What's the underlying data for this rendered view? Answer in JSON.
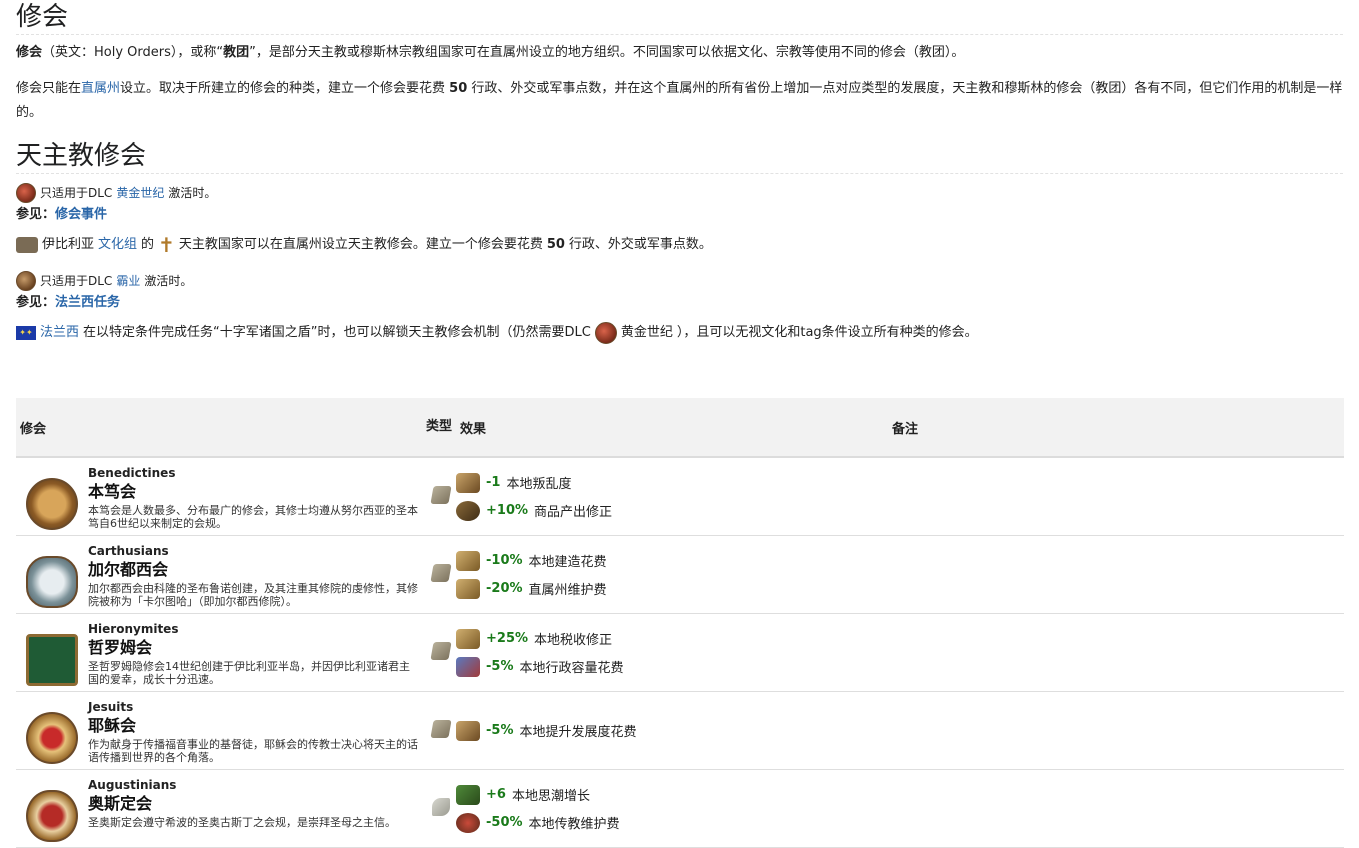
{
  "title": "修会",
  "intro": {
    "term": "修会",
    "part1": "（英文：Holy Orders），或称“",
    "alias": "教团",
    "part2": "”，是部分天主教或穆斯林宗教组国家可在直属州设立的地方组织。不同国家可以依据文化、宗教等使用不同的修会（教团）。"
  },
  "para2": {
    "a": "修会只能在",
    "link": "直属州",
    "b": "设立。取决于所建立的修会的种类，建立一个修会要花费 ",
    "num": "50",
    "c": " 行政、外交或军事点数，并在这个直属州的所有省份上增加一点对应类型的发展度，天主教和穆斯林的修会（教团）各有不同，但它们作用的机制是一样的。"
  },
  "section": "天主教修会",
  "dlc1": {
    "pre": "只适用于DLC",
    "link": "黄金世纪",
    "post": "激活时。",
    "icon": "golden-century-dlc-icon"
  },
  "see1": {
    "label": "参见：",
    "link": "修会事件"
  },
  "culture_line": {
    "a": "伊比利亚",
    "link": "文化组",
    "b": "的",
    "c": "天主教国家可以在直属州设立天主教修会。建立一个修会要花费 ",
    "num": "50",
    "d": " 行政、外交或军事点数。"
  },
  "dlc2": {
    "pre": "只适用于DLC",
    "link": "霸业",
    "post": "激活时。",
    "icon": "dominion-dlc-icon"
  },
  "see2": {
    "label": "参见：",
    "link": "法兰西任务"
  },
  "france_line": {
    "link": "法兰西",
    "a": "在以特定条件完成任务“十字军诸国之盾”时，也可以解锁天主教修会机制（仍然需要DLC",
    "dlc": "黄金世纪",
    "b": "），且可以无视文化和tag条件设立所有种类的修会。"
  },
  "table": {
    "headers": {
      "order": "修会",
      "type": "类型",
      "effect": "效果",
      "note": "备注"
    },
    "rows": [
      {
        "en": "Benedictines",
        "zh": "本笃会",
        "desc": "本笃会是人数最多、分布最广的修会，其修士均遵从努尔西亚的圣本笃自6世纪以来制定的会规。",
        "type_icon": "scroll-icon",
        "effects": [
          {
            "val": "-1",
            "text": "本地叛乱度",
            "icon": "unrest-icon"
          },
          {
            "val": "+10%",
            "text": "商品产出修正",
            "icon": "goods-produced-icon"
          }
        ]
      },
      {
        "en": "Carthusians",
        "zh": "加尔都西会",
        "desc": "加尔都西会由科隆的圣布鲁诺创建，及其注重其修院的虔修性，其修院被称为「卡尔图哈」（即加尔都西修院）。",
        "type_icon": "scroll-icon",
        "effects": [
          {
            "val": "-10%",
            "text": "本地建造花费",
            "icon": "construction-cost-icon"
          },
          {
            "val": "-20%",
            "text": "直属州维护费",
            "icon": "state-maintenance-icon"
          }
        ]
      },
      {
        "en": "Hieronymites",
        "zh": "哲罗姆会",
        "desc": "圣哲罗姆隐修会14世纪创建于伊比利亚半岛，并因伊比利亚诸君主国的爱幸，成长十分迅速。",
        "type_icon": "scroll-icon",
        "effects": [
          {
            "val": "+25%",
            "text": "本地税收修正",
            "icon": "tax-modifier-icon"
          },
          {
            "val": "-5%",
            "text": "本地行政容量花费",
            "icon": "governing-cost-icon"
          }
        ]
      },
      {
        "en": "Jesuits",
        "zh": "耶稣会",
        "desc": "作为献身于传播福音事业的基督徒，耶稣会的传教士决心将天主的话语传播到世界的各个角落。",
        "type_icon": "scroll-icon",
        "effects": [
          {
            "val": "-5%",
            "text": "本地提升发展度花费",
            "icon": "development-cost-icon"
          }
        ]
      },
      {
        "en": "Augustinians",
        "zh": "奥斯定会",
        "desc": "圣奥斯定会遵守希波的圣奥古斯丁之会规，是崇拜圣母之主信。",
        "type_icon": "dove-icon",
        "effects": [
          {
            "val": "+6",
            "text": "本地思潮增长",
            "icon": "institution-growth-icon"
          },
          {
            "val": "-50%",
            "text": "本地传教维护费",
            "icon": "missionary-maintenance-icon"
          }
        ]
      }
    ]
  }
}
